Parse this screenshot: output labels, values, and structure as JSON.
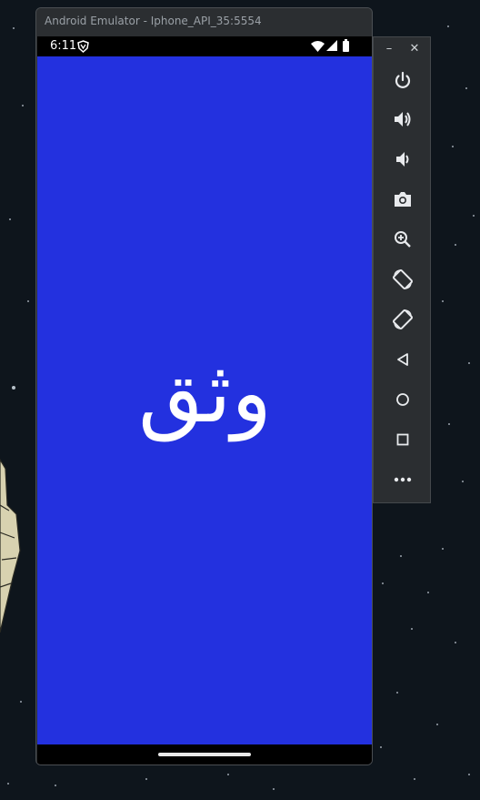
{
  "window": {
    "title": "Android Emulator - Iphone_API_35:5554"
  },
  "status_bar": {
    "time": "6:11"
  },
  "app": {
    "logo_text": "وثق",
    "background_color": "#2331df",
    "logo_color": "#ffffff"
  },
  "toolbar": {
    "minimize_label": "–",
    "close_label": "✕",
    "buttons": [
      {
        "name": "power",
        "icon": "power-icon"
      },
      {
        "name": "volume-up",
        "icon": "volume-up-icon"
      },
      {
        "name": "volume-down",
        "icon": "volume-down-icon"
      },
      {
        "name": "screenshot",
        "icon": "camera-icon"
      },
      {
        "name": "zoom",
        "icon": "zoom-in-icon"
      },
      {
        "name": "rotate-left",
        "icon": "rotate-left-icon"
      },
      {
        "name": "rotate-right",
        "icon": "rotate-right-icon"
      },
      {
        "name": "back",
        "icon": "back-triangle-icon"
      },
      {
        "name": "home",
        "icon": "home-circle-icon"
      },
      {
        "name": "overview",
        "icon": "overview-square-icon"
      },
      {
        "name": "more",
        "icon": "more-dots-icon"
      }
    ]
  },
  "colors": {
    "desktop_background": "#0e151c",
    "window_chrome": "#2b2e31",
    "title_text": "#9aa0a6"
  }
}
